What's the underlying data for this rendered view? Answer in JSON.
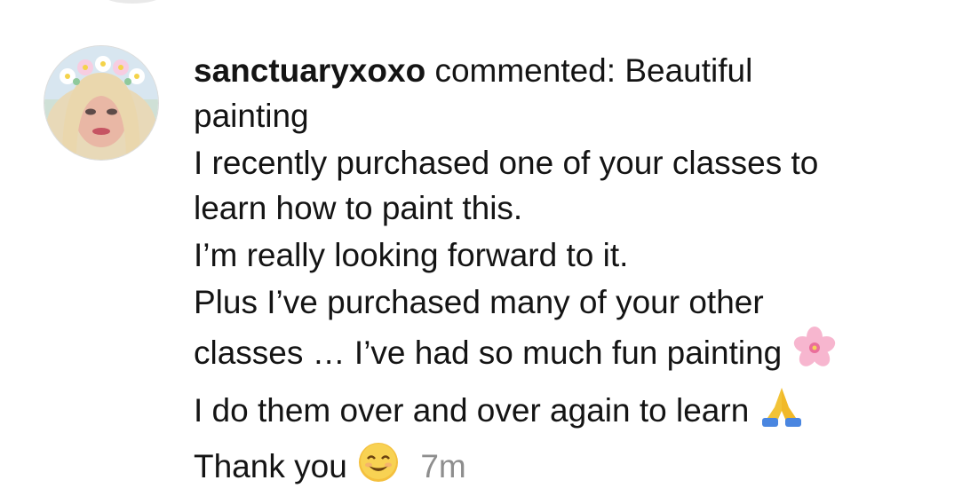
{
  "comment": {
    "username": "sanctuaryxoxo",
    "action": "commented:",
    "lines": [
      "Beautiful",
      "painting",
      "I recently purchased one of your classes to",
      "learn how to paint this.",
      "I’m really looking forward to it.",
      "Plus I’ve purchased many of your other",
      "classes … I’ve had so much fun painting",
      "I do them over and over again to learn",
      "Thank you"
    ],
    "timestamp": "7m"
  },
  "emojis": {
    "flower": "cherry-blossom",
    "prayer": "folded-hands",
    "smile": "smiling-face"
  },
  "colors": {
    "text": "#141414",
    "timestamp": "#8e8e8e",
    "blossom": "#f7b6cf",
    "hands": "#f2c337",
    "sleeve": "#4a86e0"
  }
}
